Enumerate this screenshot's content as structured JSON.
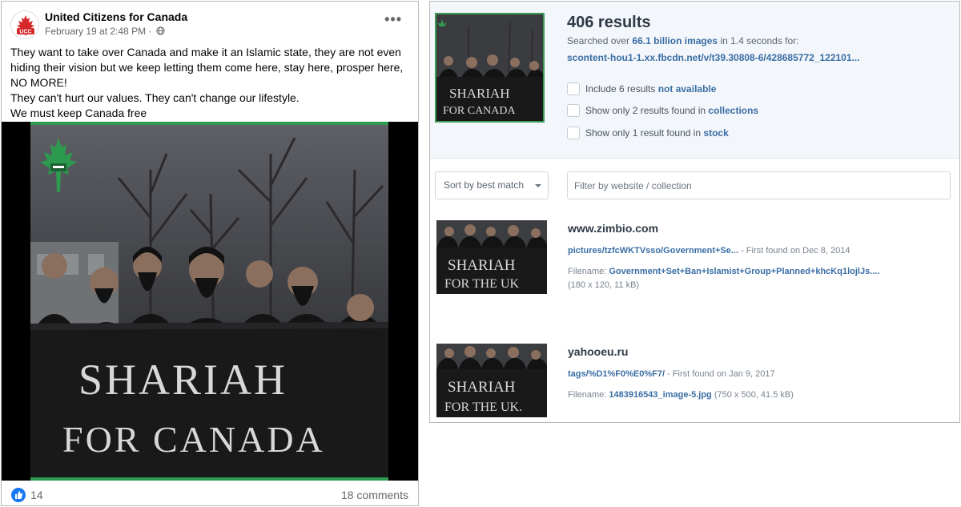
{
  "post": {
    "page_name": "United Citizens for Canada",
    "date": "February 19 at 2:48 PM",
    "separator": " · ",
    "avatar_text": "UCC",
    "text_lines": [
      "They want to take over Canada and make it an Islamic state, they are not even hiding their vision but we keep letting them come here, stay here, prosper here, NO MORE!",
      "They can't hurt our values. They can't change our lifestyle.",
      "We must keep Canada free"
    ],
    "banner_line1": "SHARIAH",
    "banner_line2": "FOR CANADA",
    "like_count": "14",
    "comments": "18 comments"
  },
  "tineye": {
    "results_title": "406 results",
    "searched_prefix": "Searched over ",
    "searched_count": "66.1 billion images",
    "searched_suffix": " in 1.4 seconds for:",
    "query_url": "scontent-hou1-1.xx.fbcdn.net/v/t39.30808-6/428685772_122101...",
    "filters": [
      {
        "prefix": "Include 6 results ",
        "link": "not available"
      },
      {
        "prefix": "Show only 2 results found in ",
        "link": "collections"
      },
      {
        "prefix": "Show only 1 result found in ",
        "link": "stock"
      }
    ],
    "sort_label": "Sort by best match",
    "filter_placeholder": "Filter by website / collection",
    "results": [
      {
        "domain": "www.zimbio.com",
        "path": "pictures/tzfcWKTVsso/Government+Se...",
        "found": " - First found on Dec 8, 2014",
        "filename_label": "Filename: ",
        "filename": "Government+Set+Ban+Islamist+Group+Planned+khcKq1lojlJs....",
        "size": "(180 x 120, 11 kB)",
        "banner_line1": "SHARIAH",
        "banner_line2": "FOR THE UK"
      },
      {
        "domain": "yahooeu.ru",
        "path": "tags/%D1%F0%E0%F7/",
        "found": " - First found on Jan 9, 2017",
        "filename_label": "Filename: ",
        "filename": "1483916543_image-5.jpg",
        "size": " (750 x 500, 41.5 kB)",
        "banner_line1": "SHARIAH",
        "banner_line2": "FOR THE UK."
      }
    ]
  },
  "colors": {
    "facebook_blue": "#1877f2",
    "tineye_link": "#3a6ea5",
    "logo_green": "#2e9a4f",
    "avatar_red": "#d62828"
  }
}
